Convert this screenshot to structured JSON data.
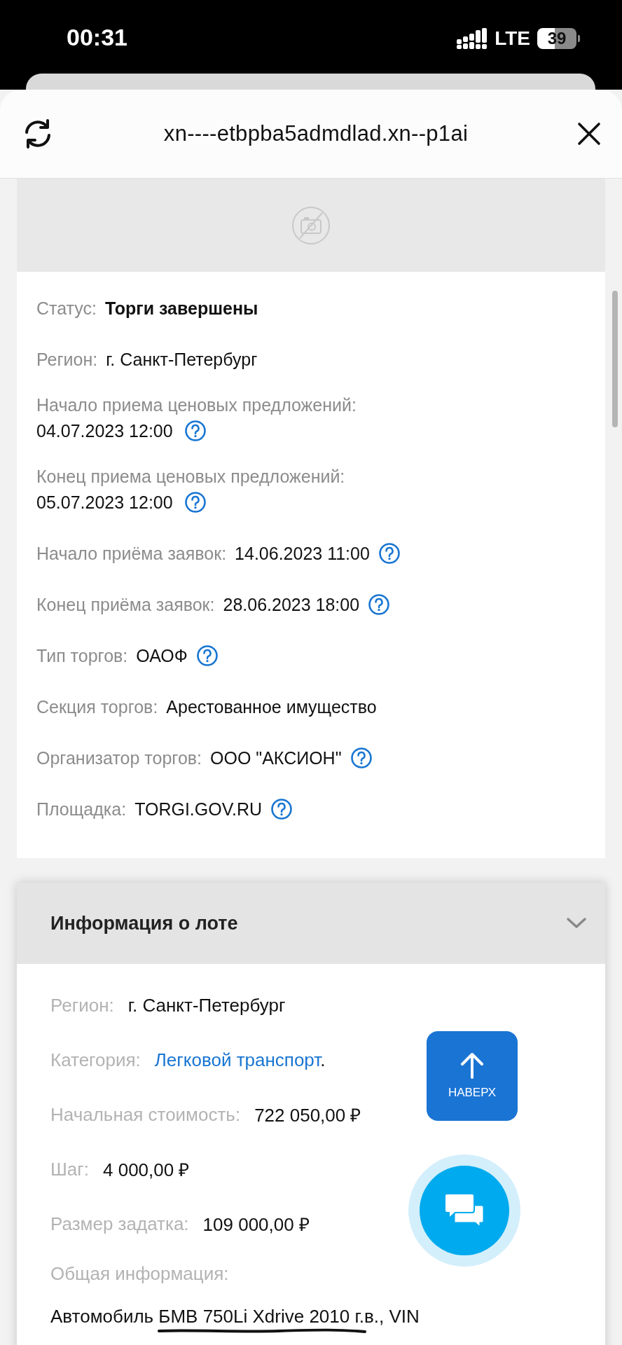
{
  "status_bar": {
    "time": "00:31",
    "network": "LTE",
    "battery": "39"
  },
  "browser": {
    "url": "xn----etbpba5admdlad.xn--p1ai"
  },
  "auction_info": {
    "rows": [
      {
        "label": "Статус:",
        "value": "Торги завершены",
        "kind": "inline",
        "bold": true,
        "help": false
      },
      {
        "label": "Регион:",
        "value": "г. Санкт-Петербург",
        "kind": "inline",
        "bold": false,
        "help": false
      },
      {
        "label": "Начало приема ценовых предложений:",
        "value": "04.07.2023 12:00",
        "kind": "stacked",
        "bold": false,
        "help": true
      },
      {
        "label": "Конец приема ценовых предложений:",
        "value": "05.07.2023 12:00",
        "kind": "stacked",
        "bold": false,
        "help": true
      },
      {
        "label": "Начало приёма заявок:",
        "value": "14.06.2023 11:00",
        "kind": "inline",
        "bold": false,
        "help": true
      },
      {
        "label": "Конец приёма заявок:",
        "value": "28.06.2023 18:00",
        "kind": "inline",
        "bold": false,
        "help": true
      },
      {
        "label": "Тип торгов:",
        "value": "ОАОФ",
        "kind": "inline",
        "bold": false,
        "help": true
      },
      {
        "label": "Секция торгов:",
        "value": "Арестованное имущество",
        "kind": "inline",
        "bold": false,
        "help": false
      },
      {
        "label": "Организатор торгов:",
        "value": "ООО \"АКСИОН\"",
        "kind": "inline",
        "bold": false,
        "help": true
      },
      {
        "label": "Площадка:",
        "value": "TORGI.GOV.RU",
        "kind": "inline",
        "bold": false,
        "help": true
      }
    ]
  },
  "lot_info": {
    "title": "Информация о лоте",
    "expanded": true,
    "rows": [
      {
        "label": "Регион:",
        "value": "г. Санкт-Петербург",
        "kind": "text"
      },
      {
        "label": "Категория:",
        "value": "Легковой транспорт",
        "suffix": ".",
        "kind": "link"
      },
      {
        "label": "Начальная стоимость:",
        "value": "722 050,00 ₽",
        "kind": "text"
      },
      {
        "label": "Шаг:",
        "value": "4 000,00 ₽",
        "kind": "text"
      },
      {
        "label": "Размер задатка:",
        "value": "109 000,00 ₽",
        "kind": "text"
      },
      {
        "label": "Общая информация:",
        "value": "Автомобиль БМВ 750Li Xdrive 2010 г.в., VIN",
        "kind": "redacted"
      }
    ]
  },
  "scroll_top_button": {
    "label": "НАВЕРХ"
  }
}
